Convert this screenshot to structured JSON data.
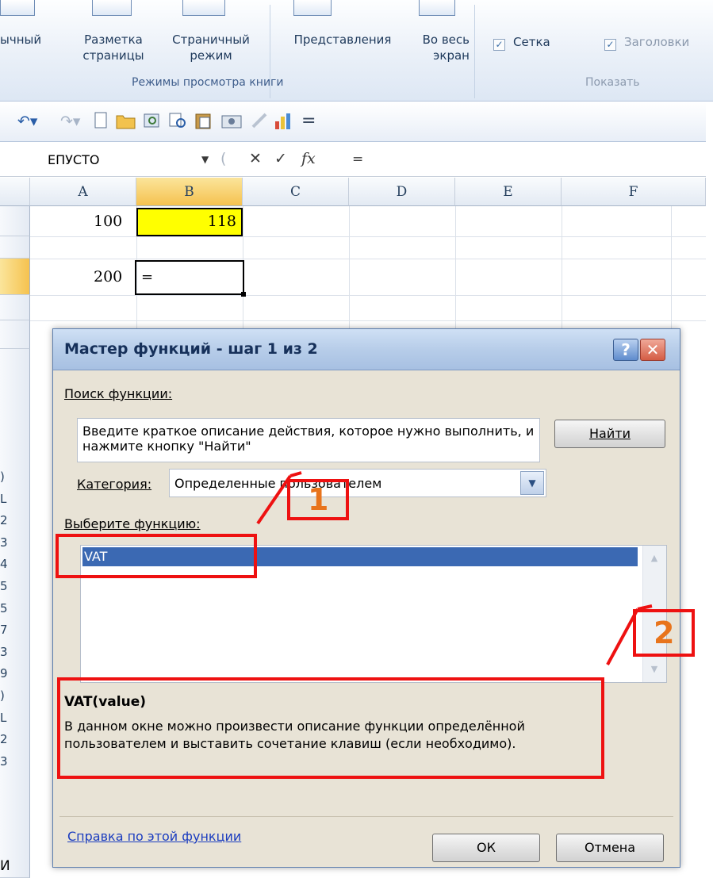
{
  "ribbon": {
    "views": [
      {
        "line1": "ычный",
        "line2": ""
      },
      {
        "line1": "Разметка",
        "line2": "страницы"
      },
      {
        "line1": "Страничный",
        "line2": "режим"
      },
      {
        "line1": "Представления",
        "line2": ""
      },
      {
        "line1": "Во весь",
        "line2": "экран"
      }
    ],
    "views_group_label": "Режимы просмотра книги",
    "show_items": [
      {
        "label": "Сетка",
        "checked": true
      },
      {
        "label": "Заголовки",
        "checked": true
      }
    ],
    "show_group_label": "Показать"
  },
  "quick_access": {
    "undo_icon": "↶▾",
    "redo_icon": "↷▾",
    "icons": [
      "new-document-icon",
      "open-folder-icon",
      "print-preview-icon",
      "print-icon",
      "paste-icon",
      "camera-icon",
      "edit-icon",
      "chart-icon"
    ],
    "more_icon": "="
  },
  "formula_bar": {
    "name_box": "ЕПУСТО",
    "cancel_symbol": "✕",
    "enter_symbol": "✓",
    "fx_symbol": "fx",
    "content": "="
  },
  "grid": {
    "columns": [
      "A",
      "B",
      "C",
      "D",
      "E",
      "F"
    ],
    "selected_column": "B",
    "cells": [
      {
        "ref": "A1",
        "value": "100"
      },
      {
        "ref": "B1",
        "value": "118"
      },
      {
        "ref": "A3",
        "value": "200"
      },
      {
        "ref": "B3",
        "value": "="
      }
    ],
    "row_labels": [
      "",
      "",
      "",
      "",
      "",
      "",
      "",
      "",
      "",
      "",
      "",
      ")",
      "L",
      "2",
      "3",
      "4",
      "5",
      "5",
      "7",
      "3",
      "9",
      ")",
      "L",
      "2",
      "3"
    ],
    "highlight_color": "#ffff00"
  },
  "dialog": {
    "title": "Мастер функций - шаг 1 из 2",
    "help_button": "?",
    "close_button": "✕",
    "search_label": "Поиск функции:",
    "search_text": "Введите краткое описание действия, которое нужно выполнить, и нажмите кнопку \"Найти\"",
    "find_button": "Найти",
    "category_label": "Категория:",
    "category_value": "Определенные пользователем",
    "choose_label": "Выберите функцию:",
    "functions": [
      "VAT"
    ],
    "selected_signature": "VAT(value)",
    "description": "В данном окне можно произвести описание функции определённой пользователем и выставить сочетание клавиш (если необходимо).",
    "help_link": "Справка по этой функции",
    "ok_button": "ОК",
    "cancel_button": "Отмена"
  },
  "annotations": {
    "marker_1": "1",
    "marker_2": "2",
    "color": "#ee1111"
  },
  "stray_text": "И"
}
